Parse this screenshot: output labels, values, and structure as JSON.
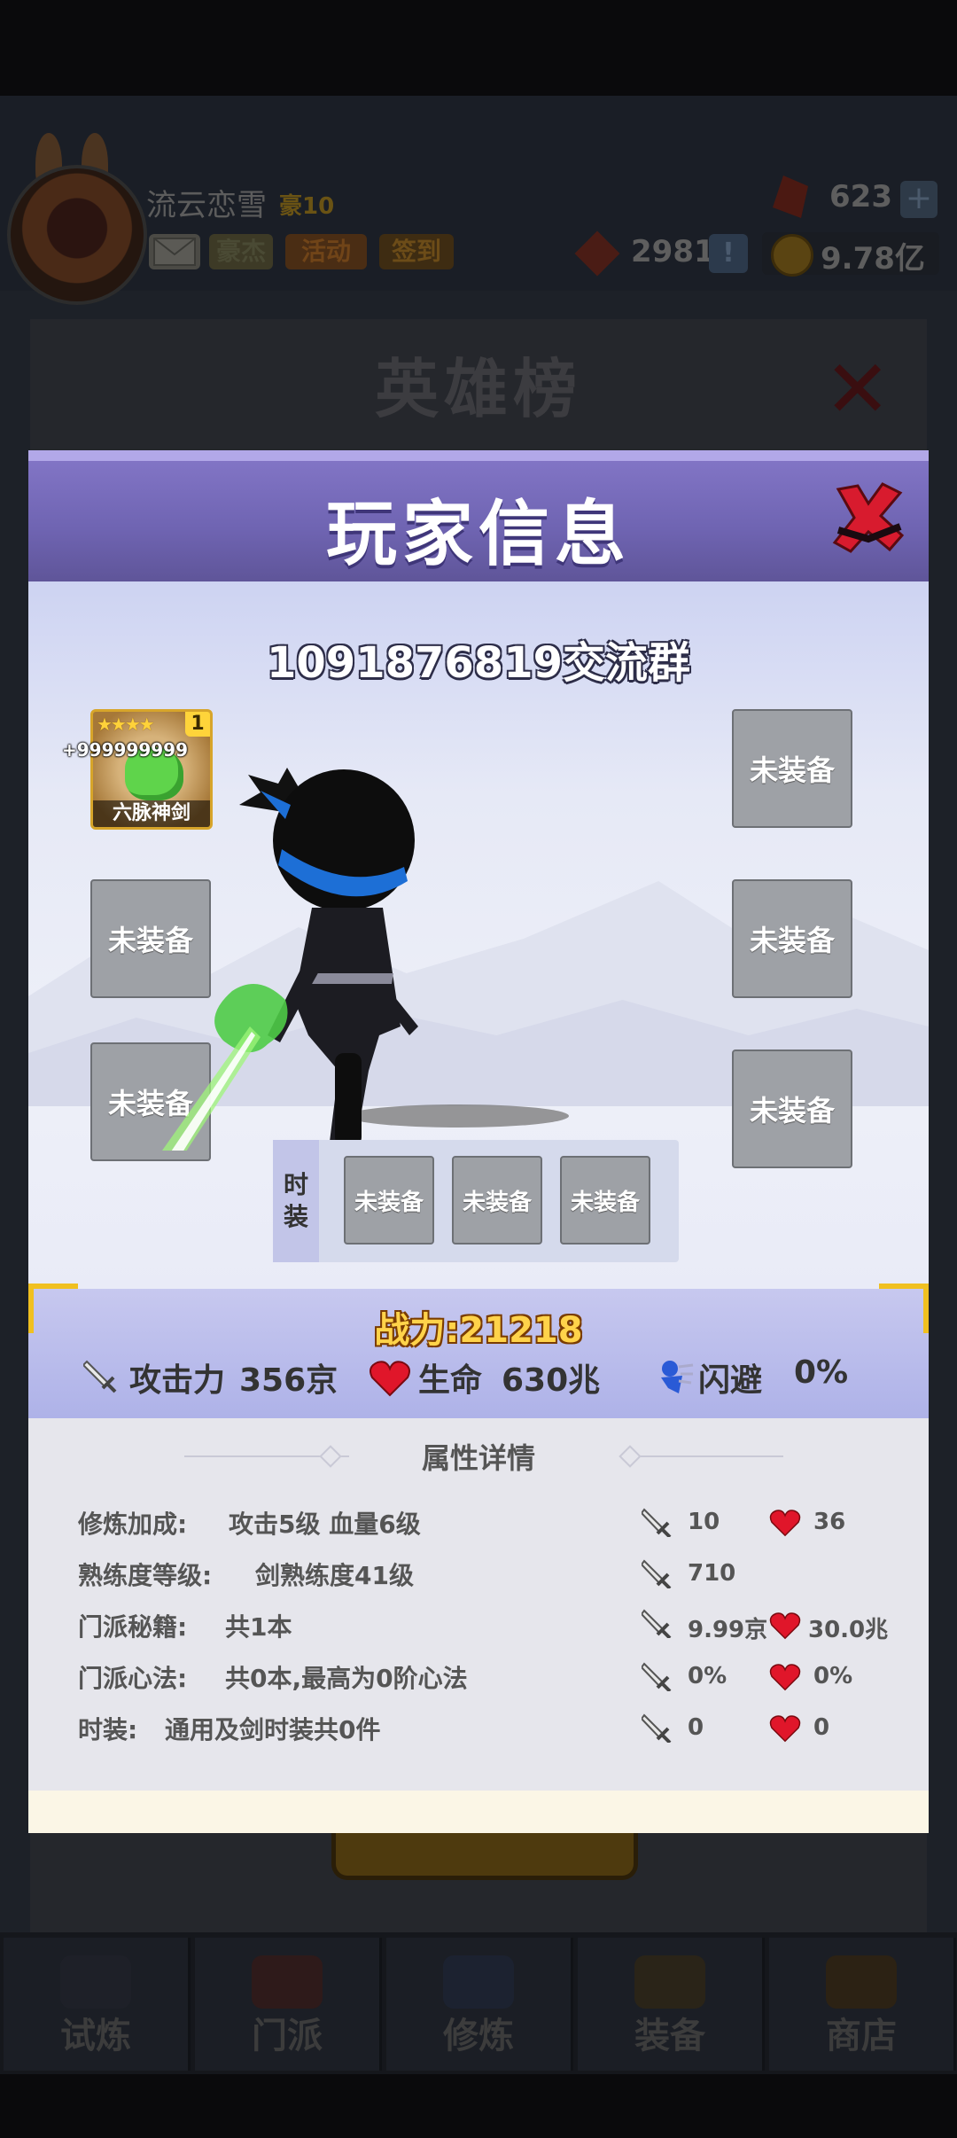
{
  "background": {
    "player_nickname": "流云恋雪",
    "vip_label": "豪10",
    "buttons": {
      "mail": "",
      "hero": "豪杰",
      "activity": "活动",
      "signin": "签到"
    },
    "gems": "623",
    "rune": "2981",
    "coins": "9.78亿",
    "hero_board_title": "英雄榜",
    "nav": [
      "试炼",
      "门派",
      "修炼",
      "装备",
      "商店"
    ]
  },
  "modal": {
    "title": "玩家信息",
    "player_name": "1091876819交流群",
    "item": {
      "name": "六脉神剑",
      "stars": "★★★★",
      "level": "1",
      "quantity": "+999999999"
    },
    "empty_slot": "未装备",
    "costume_label": [
      "时",
      "装"
    ],
    "power": "战力:21218",
    "stats": {
      "attack_label": "攻击力",
      "attack_value": "356京",
      "hp_label": "生命",
      "hp_value": "630兆",
      "dodge_label": "闪避",
      "dodge_value": "0%"
    },
    "details_title": "属性详情",
    "details": [
      {
        "label": "修炼加成:",
        "desc": "攻击5级 血量6级",
        "atk": "10",
        "hp": "36"
      },
      {
        "label": "熟练度等级:",
        "desc": "剑熟练度41级",
        "atk": "710",
        "hp": ""
      },
      {
        "label": "门派秘籍:",
        "desc": "共1本",
        "atk": "9.99京",
        "hp": "30.0兆"
      },
      {
        "label": "门派心法:",
        "desc": "共0本,最高为0阶心法",
        "atk": "0%",
        "hp": "0%"
      },
      {
        "label": "时装:",
        "desc": "通用及剑时装共0件",
        "atk": "0",
        "hp": "0"
      }
    ]
  },
  "colors": {
    "header": "#7367b6",
    "gold": "#ffd34a",
    "heart": "#e0162a",
    "slot": "#9ea1a6"
  },
  "icons": [
    "close-icon",
    "sword-icon",
    "heart-icon",
    "dodge-icon",
    "gem-icon",
    "coin-icon",
    "rune-icon",
    "plus-icon"
  ]
}
